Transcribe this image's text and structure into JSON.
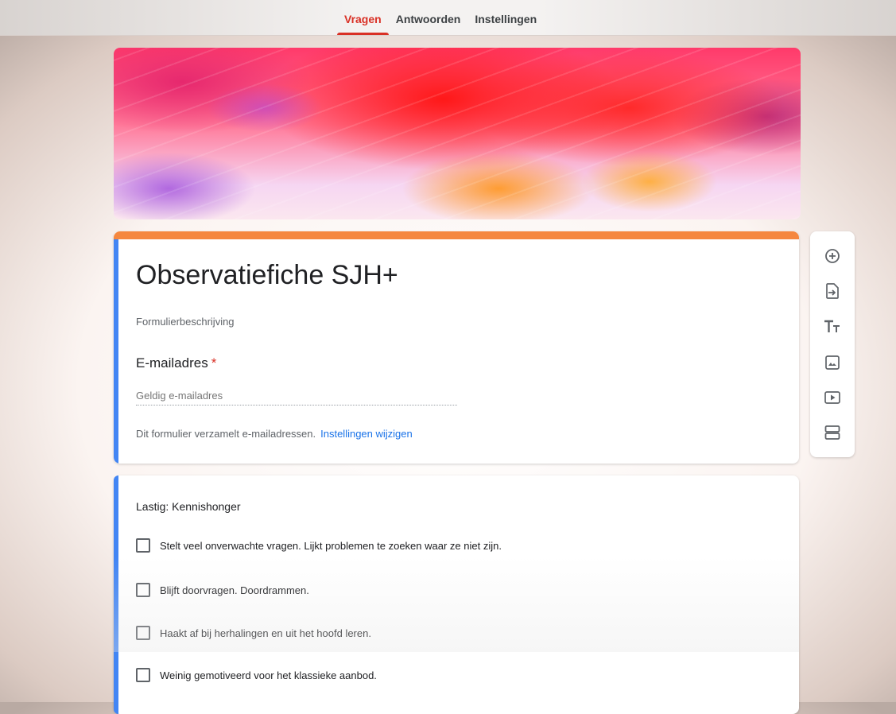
{
  "tabs": [
    {
      "label": "Vragen",
      "active": true
    },
    {
      "label": "Antwoorden",
      "active": false
    },
    {
      "label": "Instellingen",
      "active": false
    }
  ],
  "form": {
    "title": "Observatiefiche SJH+",
    "description_placeholder": "Formulierbeschrijving",
    "email_label": "E-mailadres",
    "email_required_mark": "*",
    "email_placeholder": "Geldig e-mailadres",
    "collect_note": "Dit formulier verzamelt e-mailadressen.",
    "settings_link": "Instellingen wijzigen"
  },
  "question": {
    "title": "Lastig: Kennishonger",
    "options": [
      "Stelt veel onverwachte vragen. Lijkt problemen te zoeken waar ze niet zijn.",
      "Blijft doorvragen. Doordrammen.",
      "Haakt af bij herhalingen en uit het hoofd leren.",
      "Weinig gemotiveerd voor het klassieke aanbod."
    ]
  },
  "toolbar": {
    "icons": [
      "add-question-icon",
      "import-questions-icon",
      "add-title-icon",
      "add-image-icon",
      "add-video-icon",
      "add-section-icon"
    ]
  },
  "colors": {
    "accent": "#d93025",
    "header_stripe": "#f5873f",
    "left_indicator": "#4285f4",
    "link": "#1a73e8"
  }
}
